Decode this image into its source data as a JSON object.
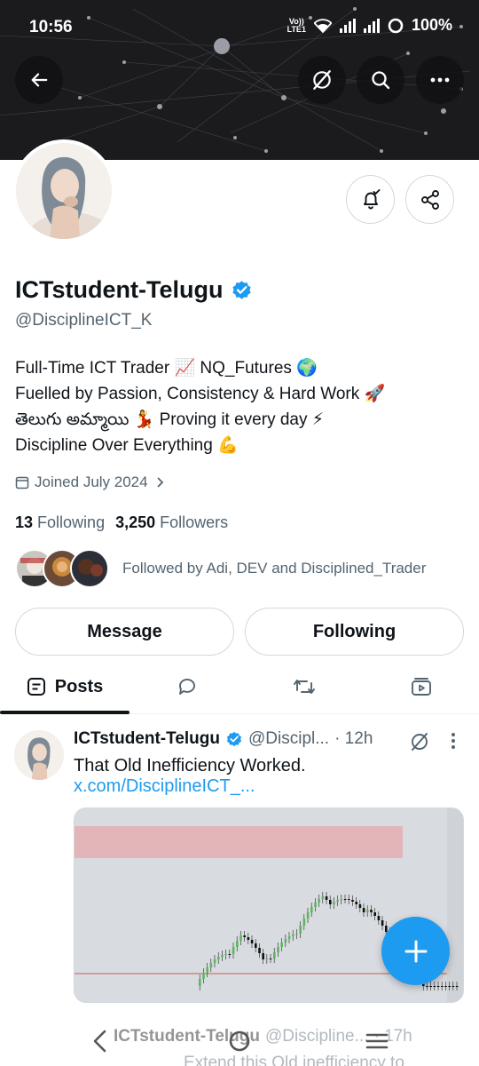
{
  "status_bar": {
    "time": "10:56",
    "volte_line1": "Vo))",
    "volte_line2": "LTE1",
    "battery": "100%"
  },
  "header_actions": {
    "back_icon": "arrow-left-icon",
    "grok_icon": "grok-icon",
    "search_icon": "search-icon",
    "more_icon": "more-horizontal-icon"
  },
  "profile": {
    "display_name": "ICTstudent-Telugu",
    "handle": "@DisciplineICT_K",
    "verified": true,
    "bio": [
      "Full-Time ICT Trader 📈 NQ_Futures  🌍",
      "Fuelled by Passion, Consistency & Hard Work 🚀",
      "తెలుగు అమ్మాయి 💃 Proving  it every day ⚡",
      "Discipline Over Everything 💪"
    ],
    "joined": "Joined July 2024",
    "following_count": "13",
    "following_label": "Following",
    "followers_count": "3,250",
    "followers_label": "Followers",
    "followed_by": "Followed by Adi, DEV and Disciplined_Trader",
    "message_button": "Message",
    "following_button": "Following"
  },
  "tabs": [
    {
      "label": "Posts",
      "icon": "posts-icon",
      "active": true
    },
    {
      "label": "",
      "icon": "replies-icon",
      "active": false
    },
    {
      "label": "",
      "icon": "repost-icon",
      "active": false
    },
    {
      "label": "",
      "icon": "media-icon",
      "active": false
    }
  ],
  "post": {
    "author": "ICTstudent-Telugu",
    "handle": "@Discipl...",
    "time": "· 12h",
    "text": "That Old Inefficiency Worked.",
    "link": "x.com/DisciplineICT_..."
  },
  "next_post": {
    "author": "ICTstudent-Telugu",
    "handle": "@Discipline...",
    "time": "· 17h",
    "text": "Extend this Old inefficiency to"
  },
  "colors": {
    "accent": "#1d9bf0",
    "text": "#0f1419",
    "muted": "#536471",
    "border": "#cfd9de"
  }
}
